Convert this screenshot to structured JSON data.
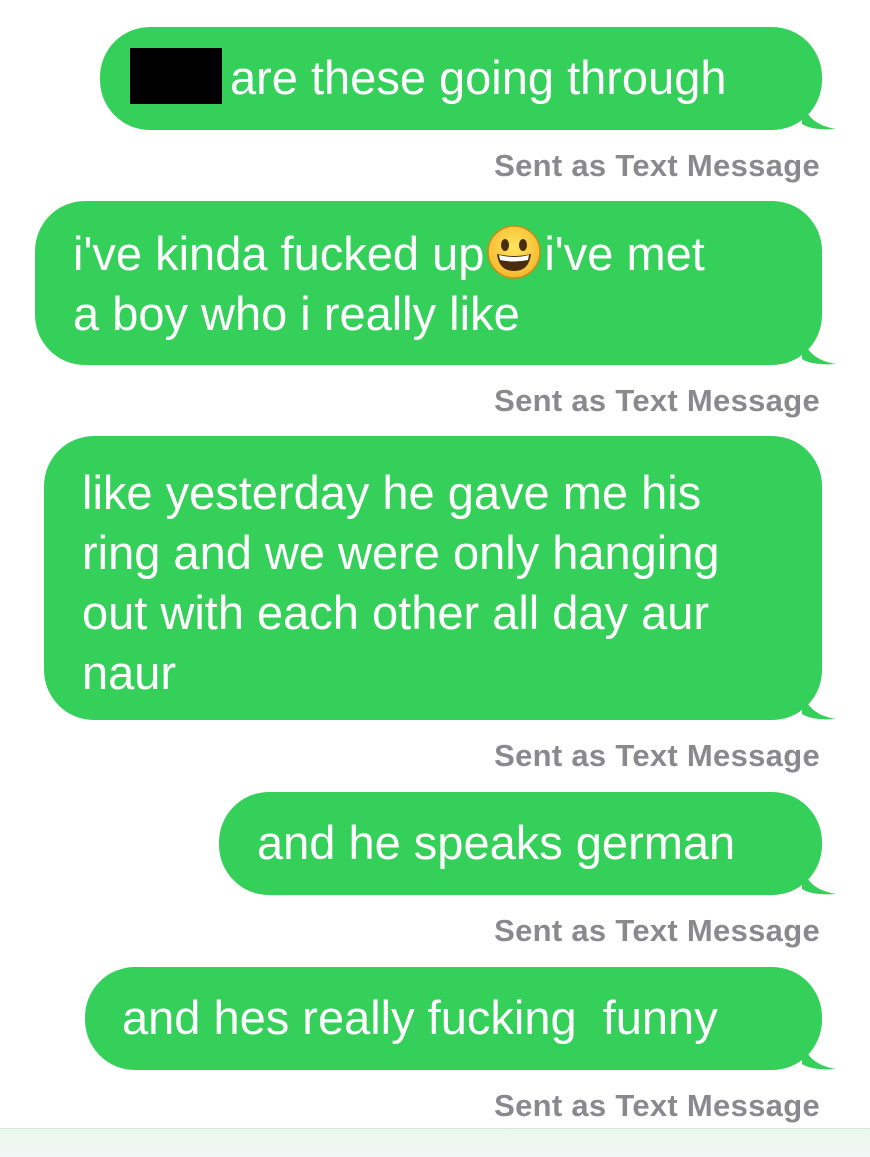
{
  "messages": [
    {
      "text": "are these going through",
      "has_redaction": true,
      "status": "Sent as Text Message"
    },
    {
      "text_before_emoji": "i've kinda fucked up",
      "emoji": "grinning-face",
      "text_after_emoji": "i've met\na boy who i really like",
      "status": "Sent as Text Message"
    },
    {
      "text": "like yesterday he gave me his\nring and we were only hanging\nout with each other all day aur\nnaur",
      "status": "Sent as Text Message"
    },
    {
      "text": "and he speaks german",
      "status": "Sent as Text Message"
    },
    {
      "text": "and hes really fucking  funny",
      "status": "Sent as Text Message"
    }
  ],
  "colors": {
    "sms_bubble": "#35d05a",
    "bubble_text": "#ffffff",
    "status_text": "#8a8a8e",
    "background": "#ffffff"
  }
}
